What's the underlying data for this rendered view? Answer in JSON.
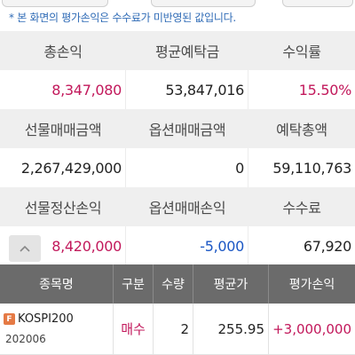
{
  "note": "* 본 화면의 평가손익은 수수료가 미반영된 값입니다.",
  "summary": {
    "row1_headers": [
      "총손익",
      "평균예탁금",
      "수익률"
    ],
    "row1_values": [
      "8,347,080",
      "53,847,016",
      "15.50%"
    ],
    "row2_headers": [
      "선물매매금액",
      "옵션매매금액",
      "예탁총액"
    ],
    "row2_values": [
      "2,267,429,000",
      "0",
      "59,110,763"
    ],
    "row3_headers": [
      "선물정산손익",
      "옵션매매손익",
      "수수료"
    ],
    "row3_values": [
      "8,420,000",
      "-5,000",
      "67,920"
    ]
  },
  "up_button": "^",
  "table": {
    "columns": [
      "종목명",
      "구분",
      "수량",
      "평균가",
      "평가손익"
    ],
    "rows": [
      {
        "badge": "F",
        "name": "KOSPI200",
        "code": "202006",
        "type": "매수",
        "qty": "2",
        "avg_price": "255.95",
        "pnl": "+3,000,000"
      }
    ]
  },
  "colors": {
    "positive": "#c2185b",
    "negative": "#1a56c4",
    "note": "#2f6bb6",
    "table_header_bg": "#6b6b6b"
  }
}
